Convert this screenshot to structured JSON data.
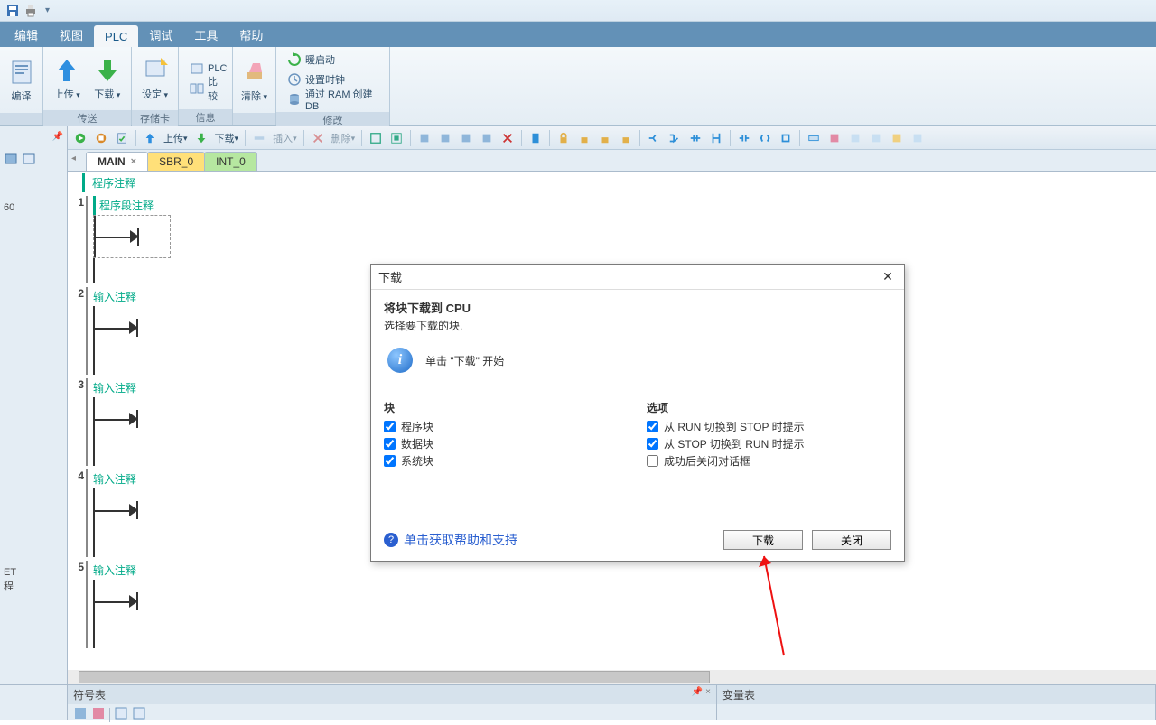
{
  "qat": {
    "icon1": "disk-icon",
    "icon2": "printer-icon"
  },
  "menu": {
    "items": [
      "编辑",
      "视图",
      "PLC",
      "调试",
      "工具",
      "帮助"
    ],
    "activeIndex": 2
  },
  "ribbon": {
    "groups": {
      "g0": {
        "label": "",
        "btns": {
          "compile": "编译"
        }
      },
      "transfer": {
        "label": "传送",
        "upload": "上传",
        "download": "下载"
      },
      "memcard": {
        "label": "存储卡",
        "settings": "设定"
      },
      "info": {
        "label": "信息",
        "plc": "PLC",
        "compare": "比较"
      },
      "clear": {
        "label": "",
        "clear": "清除"
      },
      "modify": {
        "label": "修改",
        "warmStart": "暖启动",
        "setClock": "设置时钟",
        "createDB": "通过 RAM 创建 DB"
      }
    }
  },
  "toolbar": {
    "upload": "上传",
    "download": "下载",
    "insert": "插入",
    "delete": "删除"
  },
  "tabs": {
    "main": "MAIN",
    "sbr": "SBR_0",
    "int": "INT_0"
  },
  "editor": {
    "progComment": "程序注释",
    "networks": [
      {
        "num": "1",
        "comment": "程序段注释",
        "dashed": true
      },
      {
        "num": "2",
        "comment": "输入注释",
        "dashed": false
      },
      {
        "num": "3",
        "comment": "输入注释",
        "dashed": false
      },
      {
        "num": "4",
        "comment": "输入注释",
        "dashed": false
      },
      {
        "num": "5",
        "comment": "输入注释",
        "dashed": false
      }
    ]
  },
  "sidetext": {
    "l1": "60",
    "l2": "ET",
    "l3": "程"
  },
  "dialog": {
    "title": "下载",
    "heading": "将块下载到 CPU",
    "subheading": "选择要下载的块.",
    "infoText": "单击 \"下载\" 开始",
    "blocksHeader": "块",
    "blocks": [
      {
        "label": "程序块",
        "checked": true
      },
      {
        "label": "数据块",
        "checked": true
      },
      {
        "label": "系统块",
        "checked": true
      }
    ],
    "optionsHeader": "选项",
    "options": [
      {
        "label": "从 RUN 切换到 STOP 时提示",
        "checked": true
      },
      {
        "label": "从 STOP 切换到 RUN 时提示",
        "checked": true
      },
      {
        "label": "成功后关闭对话框",
        "checked": false
      }
    ],
    "helpText": "单击获取帮助和支持",
    "downloadBtn": "下载",
    "closeBtn": "关闭"
  },
  "bottom": {
    "symbolTable": "符号表",
    "varTable": "变量表"
  }
}
